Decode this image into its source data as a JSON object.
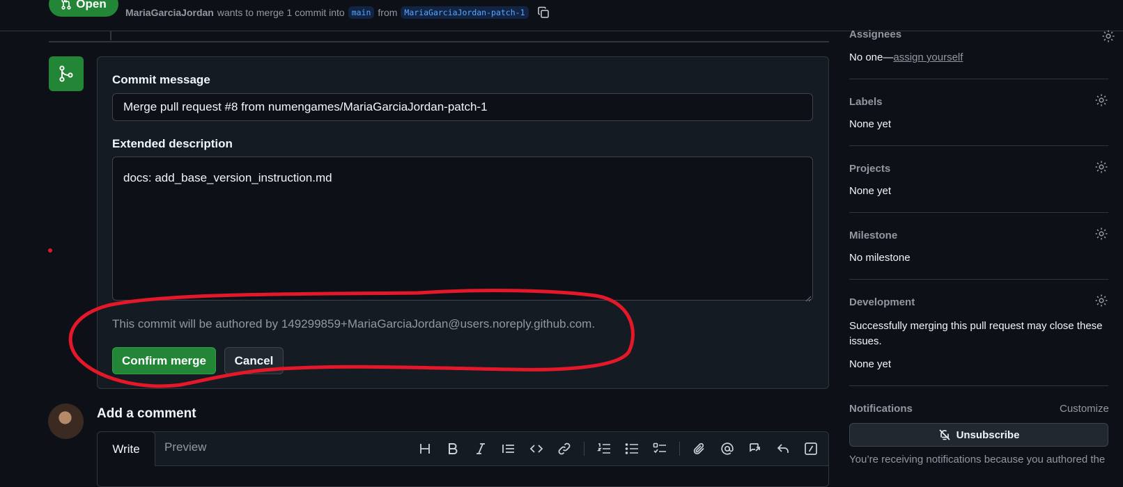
{
  "header": {
    "state": "Open",
    "author": "MariaGarciaJordan",
    "merge_text": "wants to merge 1 commit into",
    "base_branch": "main",
    "from_text": "from",
    "head_branch": "MariaGarciaJordan-patch-1"
  },
  "merge_form": {
    "commit_label": "Commit message",
    "commit_value": "Merge pull request #8 from numengames/MariaGarciaJordan-patch-1",
    "extended_label": "Extended description",
    "extended_value": "docs: add_base_version_instruction.md",
    "author_note": "This commit will be authored by 149299859+MariaGarciaJordan@users.noreply.github.com.",
    "confirm_label": "Confirm merge",
    "cancel_label": "Cancel"
  },
  "comment": {
    "title": "Add a comment",
    "tab_write": "Write",
    "tab_preview": "Preview"
  },
  "sidebar": {
    "assignees_title": "Assignees",
    "assignees_none": "No one—",
    "assignees_link": "assign yourself",
    "labels_title": "Labels",
    "labels_value": "None yet",
    "projects_title": "Projects",
    "projects_value": "None yet",
    "milestone_title": "Milestone",
    "milestone_value": "No milestone",
    "development_title": "Development",
    "development_note": "Successfully merging this pull request may close these issues.",
    "development_value": "None yet",
    "notifications_title": "Notifications",
    "notifications_customize": "Customize",
    "unsubscribe_label": "Unsubscribe",
    "notifications_note": "You’re receiving notifications because you authored the"
  },
  "colors": {
    "accent_green": "#238636",
    "annotation_red": "#e5182a",
    "link_blue": "#58a6ff"
  }
}
